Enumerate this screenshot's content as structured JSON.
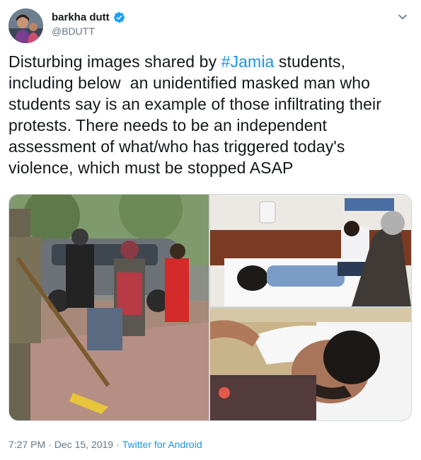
{
  "author": {
    "display_name": "barkha dutt",
    "handle": "@BDUTT",
    "verified": true
  },
  "tweet": {
    "text_before": "Disturbing images shared by ",
    "hashtag": "#Jamia",
    "text_after": " students, including below  an unidentified masked man who students say is an example of those infiltrating their protests. There needs to be an independent assessment of what/who has triggered today's violence, which must be stopped ASAP"
  },
  "media": {
    "photo_count": 3
  },
  "meta": {
    "time": "7:27 PM",
    "separator": "·",
    "date": "Dec 15, 2019",
    "source": "Twitter for Android"
  },
  "icons": {
    "verified": "verified-badge-icon",
    "menu": "chevron-down-icon"
  },
  "colors": {
    "link": "#1b95e0",
    "secondary_text": "#657786",
    "verified": "#1da1f2"
  }
}
